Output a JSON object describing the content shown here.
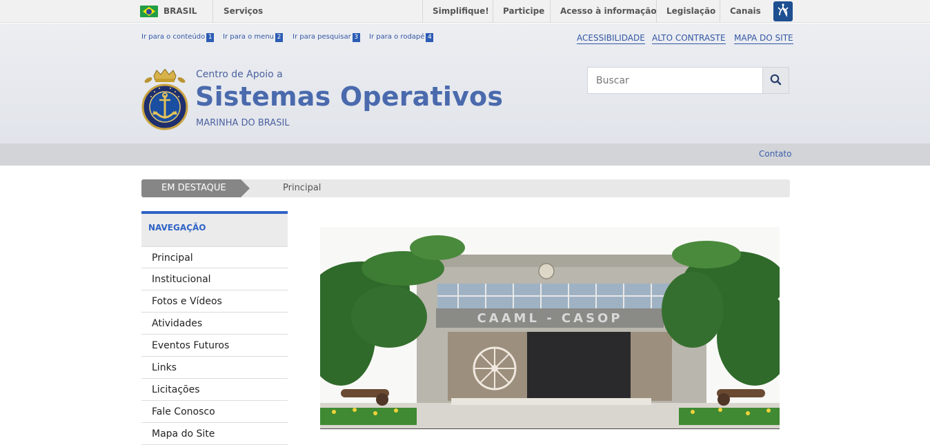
{
  "gov_bar": {
    "country": "BRASIL",
    "services": "Serviços",
    "links": [
      "Simplifique!",
      "Participe",
      "Acesso à informação",
      "Legislação",
      "Canais"
    ]
  },
  "access_links": [
    {
      "label": "Ir para o conteúdo",
      "num": "1"
    },
    {
      "label": "Ir para o menu",
      "num": "2"
    },
    {
      "label": "Ir para pesquisar",
      "num": "3"
    },
    {
      "label": "Ir para o rodapé",
      "num": "4"
    }
  ],
  "access_right": [
    "ACESSIBILIDADE",
    "ALTO CONTRASTE",
    "MAPA DO SITE"
  ],
  "site": {
    "pre_title": "Centro de Apoio a",
    "title": "Sistemas Operativos",
    "subtitle": "MARINHA DO BRASIL",
    "logo_text": "MARINHA DO BRASIL"
  },
  "search": {
    "placeholder": "Buscar"
  },
  "nav_strip": {
    "contato": "Contato"
  },
  "destaque": {
    "tag": "EM DESTAQUE",
    "text": "Principal"
  },
  "sidebar": {
    "heading": "NAVEGAÇÃO",
    "items": [
      "Principal",
      "Institucional",
      "Fotos e Vídeos",
      "Atividades",
      "Eventos Futuros",
      "Links",
      "Licitações",
      "Fale Conosco",
      "Mapa do Site"
    ]
  },
  "photo": {
    "sign": "CAAML - CASOP"
  },
  "colors": {
    "brand_blue": "#4a6aad",
    "link_blue": "#3456a3",
    "accent": "#2e63c5"
  }
}
